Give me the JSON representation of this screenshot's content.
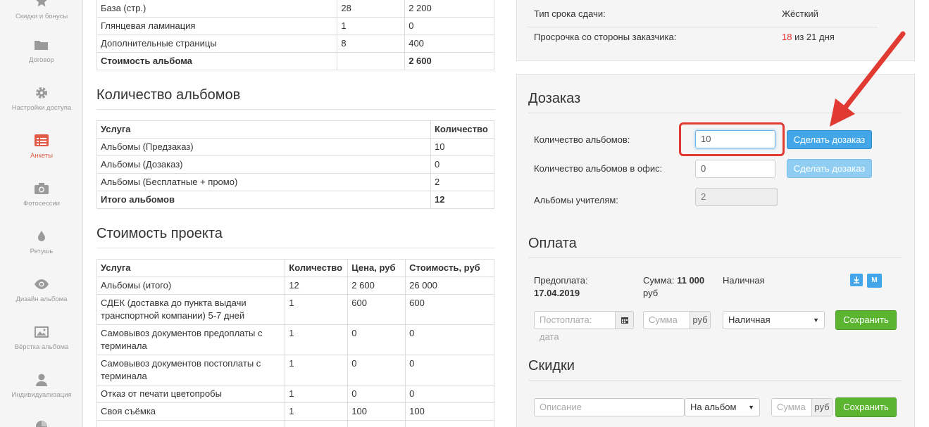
{
  "sidebar": [
    {
      "label": "Скидки и бонусы",
      "icon": "star-icon",
      "active": false
    },
    {
      "label": "Договор",
      "icon": "folder-icon",
      "active": false
    },
    {
      "label": "Настройки доступа",
      "icon": "gear-icon",
      "active": false
    },
    {
      "label": "Анкеты",
      "icon": "form-list-icon",
      "active": true
    },
    {
      "label": "Фотосессии",
      "icon": "camera-icon",
      "active": false
    },
    {
      "label": "Ретушь",
      "icon": "drop-icon",
      "active": false
    },
    {
      "label": "Дизайн альбома",
      "icon": "eye-icon",
      "active": false
    },
    {
      "label": "Вёрстка альбома",
      "icon": "picture-icon",
      "active": false
    },
    {
      "label": "Индивидуализация",
      "icon": "user-icon",
      "active": false
    }
  ],
  "cost_table": {
    "rows": [
      [
        "База (стр.)",
        "28",
        "2 200"
      ],
      [
        "Глянцевая ламинация",
        "1",
        "0"
      ],
      [
        "Дополнительные страницы",
        "8",
        "400"
      ]
    ],
    "total": [
      "Стоимость альбома",
      "",
      "2 600"
    ]
  },
  "albums": {
    "title": "Количество альбомов",
    "headers": [
      "Услуга",
      "Количество"
    ],
    "rows": [
      [
        "Альбомы (Предзаказ)",
        "10"
      ],
      [
        "Альбомы (Дозаказ)",
        "0"
      ],
      [
        "Альбомы (Бесплатные + промо)",
        "2"
      ]
    ],
    "total": [
      "Итого альбомов",
      "12"
    ]
  },
  "project": {
    "title": "Стоимость проекта",
    "headers": [
      "Услуга",
      "Количество",
      "Цена, руб",
      "Стоимость, руб"
    ],
    "rows": [
      [
        "Альбомы (итого)",
        "12",
        "2 600",
        "26 000"
      ],
      [
        "СДЕК (доставка до пункта выдачи транспортной компании) 5-7 дней",
        "1",
        "600",
        "600"
      ],
      [
        "Самовывоз документов предоплаты с терминала",
        "1",
        "0",
        "0"
      ],
      [
        "Самовывоз документов постоплаты с терминала",
        "1",
        "0",
        "0"
      ],
      [
        "Отказ от печати цветопробы",
        "1",
        "0",
        "0"
      ],
      [
        "Своя съёмка",
        "1",
        "100",
        "100"
      ]
    ]
  },
  "deadline": {
    "type_label": "Тип срока сдачи:",
    "type_value": "Жёсткий",
    "delay_label": "Просрочка со стороны заказчика:",
    "delay_value": "18",
    "delay_suffix": "из 21 дня"
  },
  "reorder": {
    "title": "Дозаказ",
    "albums_label": "Количество альбомов:",
    "albums_value": "10",
    "office_label": "Количество альбомов в офис:",
    "office_value": "0",
    "teachers_label": "Альбомы учителям:",
    "teachers_value": "2",
    "button": "Сделать дозаказ"
  },
  "payment": {
    "title": "Оплата",
    "prepay_label": "Предоплата:",
    "prepay_date": "17.04.2019",
    "sum_label": "Сумма:",
    "sum_value": "11 000",
    "sum_unit": "руб",
    "method": "Наличная",
    "m_button": "М",
    "postpay_placeholder": "Постоплата: дата",
    "sum_placeholder": "Сумма",
    "currency": "руб",
    "select_value": "Наличная",
    "save": "Сохранить"
  },
  "discounts": {
    "title": "Скидки",
    "desc_placeholder": "Описание",
    "target_value": "На альбом",
    "sum_placeholder": "Сумма",
    "currency": "руб",
    "save": "Сохранить"
  },
  "colors": {
    "accent_red": "#e8302e",
    "blue": "#42a6e8",
    "green": "#5cb531"
  }
}
